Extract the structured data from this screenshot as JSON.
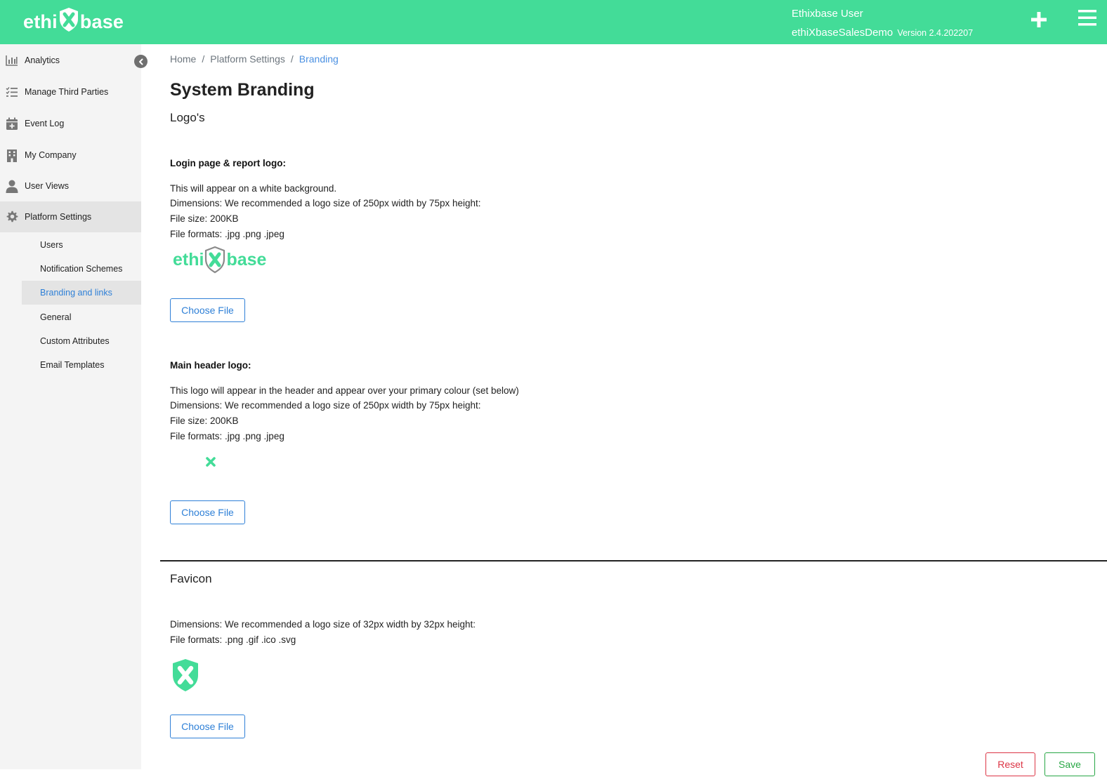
{
  "header": {
    "brand_left": "ethi",
    "brand_right": "base",
    "user_name": "Ethixbase User",
    "org_name": "ethiXbaseSalesDemo",
    "version": "Version 2.4.202207",
    "icons": {
      "add": "plus-icon",
      "menu": "hamburger-icon"
    },
    "color": "#43dc98"
  },
  "sidebar": {
    "items": [
      {
        "label": "Analytics",
        "icon": "bar-chart-icon"
      },
      {
        "label": "Manage Third Parties",
        "icon": "checklist-icon"
      },
      {
        "label": "Event Log",
        "icon": "calendar-plus-icon"
      },
      {
        "label": "My Company",
        "icon": "building-icon"
      },
      {
        "label": "User Views",
        "icon": "user-icon"
      },
      {
        "label": "Platform Settings",
        "icon": "gear-icon",
        "active": true
      }
    ],
    "sub_items": [
      {
        "label": "Users"
      },
      {
        "label": "Notification Schemes"
      },
      {
        "label": "Branding and links",
        "active": true
      },
      {
        "label": "General"
      },
      {
        "label": "Custom Attributes"
      },
      {
        "label": "Email Templates"
      }
    ]
  },
  "breadcrumb": {
    "home": "Home",
    "parent": "Platform Settings",
    "current": "Branding",
    "separator": "/"
  },
  "page": {
    "title": "System Branding",
    "logos_title": "Logo's",
    "login_logo": {
      "label": "Login page & report logo:",
      "lines": [
        "This will appear on a white background.",
        "Dimensions: We recommended a logo size of 250px width by 75px height:",
        "File size: 200KB",
        "File formats: .jpg .png .jpeg"
      ],
      "preview_left": "ethi",
      "preview_right": "base",
      "button": "Choose File"
    },
    "header_logo": {
      "label": "Main header logo:",
      "lines": [
        "This logo will appear in the header and appear over your primary colour (set below)",
        "Dimensions: We recommended a logo size of 250px width by 75px height:",
        "File size: 200KB",
        "File formats: .jpg .png .jpeg"
      ],
      "button": "Choose File"
    },
    "favicon": {
      "title": "Favicon",
      "lines": [
        "Dimensions: We recommended a logo size of 32px width by 32px height:",
        "File formats: .png .gif .ico .svg"
      ],
      "button": "Choose File"
    },
    "reset": "Reset",
    "save": "Save"
  }
}
